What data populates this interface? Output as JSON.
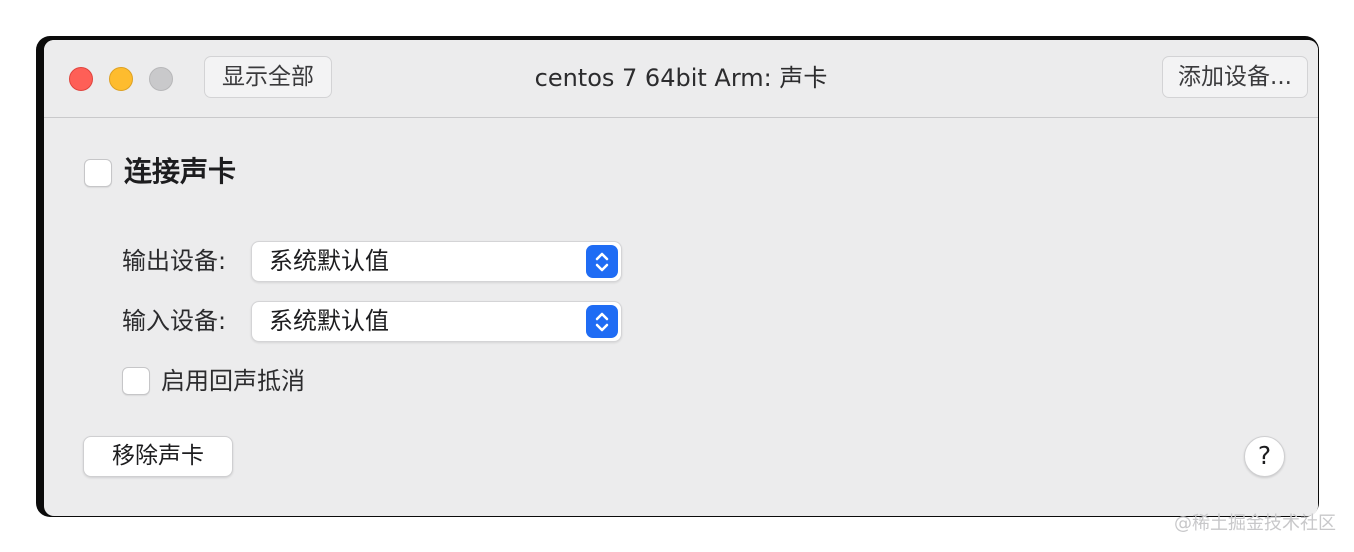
{
  "window": {
    "title": "centos 7 64bit Arm: 声卡",
    "show_all_label": "显示全部",
    "add_device_label": "添加设备..."
  },
  "sound_card": {
    "connect_label": "连接声卡",
    "connect_checked": false,
    "output": {
      "label": "输出设备:",
      "value": "系统默认值"
    },
    "input": {
      "label": "输入设备:",
      "value": "系统默认值"
    },
    "echo_cancel_label": "启用回声抵消",
    "echo_cancel_checked": false,
    "remove_label": "移除声卡",
    "help_label": "?"
  },
  "watermark": {
    "text": "@稀土掘金技术社区"
  },
  "colors": {
    "accent": "#1f6cf4",
    "close": "#fe5f57",
    "minimize": "#febc2e",
    "zoom_disabled": "#c9c9cb",
    "window_background": "#ececed"
  },
  "icons": {
    "stepper": "chevron-up-down-icon"
  }
}
